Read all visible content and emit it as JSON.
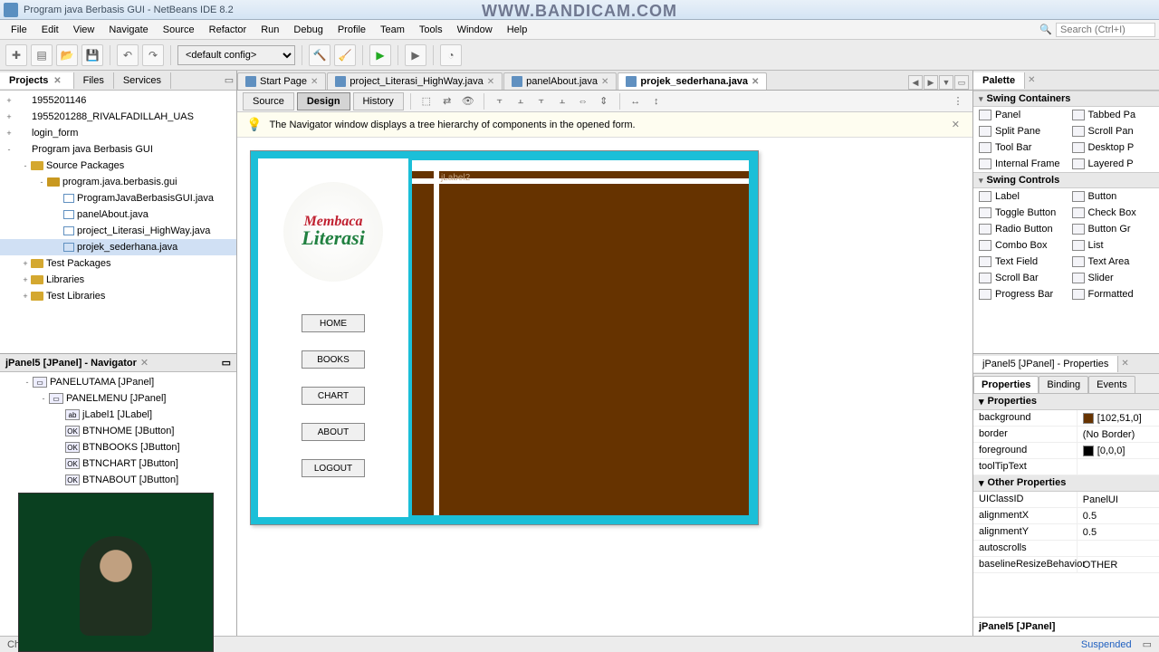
{
  "window": {
    "title": "Program java Berbasis GUI - NetBeans IDE 8.2"
  },
  "watermark": "WWW.BANDICAM.COM",
  "menubar": [
    "File",
    "Edit",
    "View",
    "Navigate",
    "Source",
    "Refactor",
    "Run",
    "Debug",
    "Profile",
    "Team",
    "Tools",
    "Window",
    "Help"
  ],
  "search_placeholder": "Search (Ctrl+I)",
  "toolbar": {
    "config": "<default config>"
  },
  "projects": {
    "tabs": [
      "Projects",
      "Files",
      "Services"
    ],
    "active_tab": 0,
    "nodes": [
      {
        "indent": 0,
        "exp": "+",
        "ico": "coffee",
        "label": "1955201146"
      },
      {
        "indent": 0,
        "exp": "+",
        "ico": "coffee",
        "label": "1955201288_RIVALFADILLAH_UAS"
      },
      {
        "indent": 0,
        "exp": "+",
        "ico": "coffee",
        "label": "login_form"
      },
      {
        "indent": 0,
        "exp": "-",
        "ico": "coffee",
        "label": "Program java Berbasis GUI"
      },
      {
        "indent": 1,
        "exp": "-",
        "ico": "folder",
        "label": "Source Packages"
      },
      {
        "indent": 2,
        "exp": "-",
        "ico": "pkg",
        "label": "program.java.berbasis.gui"
      },
      {
        "indent": 3,
        "exp": "",
        "ico": "java",
        "label": "ProgramJavaBerbasisGUI.java"
      },
      {
        "indent": 3,
        "exp": "",
        "ico": "java",
        "label": "panelAbout.java"
      },
      {
        "indent": 3,
        "exp": "",
        "ico": "java",
        "label": "project_Literasi_HighWay.java"
      },
      {
        "indent": 3,
        "exp": "",
        "ico": "java",
        "label": "projek_sederhana.java",
        "sel": true
      },
      {
        "indent": 1,
        "exp": "+",
        "ico": "folder",
        "label": "Test Packages"
      },
      {
        "indent": 1,
        "exp": "+",
        "ico": "folder",
        "label": "Libraries"
      },
      {
        "indent": 1,
        "exp": "+",
        "ico": "folder",
        "label": "Test Libraries"
      }
    ]
  },
  "navigator": {
    "title": "jPanel5 [JPanel] - Navigator",
    "nodes": [
      {
        "indent": 0,
        "exp": "-",
        "label": "PANELUTAMA [JPanel]"
      },
      {
        "indent": 1,
        "exp": "-",
        "label": "PANELMENU [JPanel]"
      },
      {
        "indent": 2,
        "exp": "",
        "label": "jLabel1 [JLabel]",
        "ico": "lbl"
      },
      {
        "indent": 2,
        "exp": "",
        "label": "BTNHOME [JButton]",
        "ico": "btn"
      },
      {
        "indent": 2,
        "exp": "",
        "label": "BTNBOOKS [JButton]",
        "ico": "btn"
      },
      {
        "indent": 2,
        "exp": "",
        "label": "BTNCHART [JButton]",
        "ico": "btn"
      },
      {
        "indent": 2,
        "exp": "",
        "label": "BTNABOUT [JButton]",
        "ico": "btn"
      }
    ]
  },
  "editor": {
    "tabs": [
      {
        "label": "Start Page"
      },
      {
        "label": "project_Literasi_HighWay.java"
      },
      {
        "label": "panelAbout.java"
      },
      {
        "label": "projek_sederhana.java",
        "active": true
      }
    ],
    "views": [
      "Source",
      "Design",
      "History"
    ],
    "active_view": 1,
    "info": "The Navigator window displays a tree hierarchy of components in the opened form."
  },
  "form": {
    "logo_word1": "Membaca",
    "logo_word2": "Literasi",
    "buttons": [
      "HOME",
      "BOOKS",
      "CHART",
      "ABOUT",
      "LOGOUT"
    ],
    "inner_label": "jLabel2"
  },
  "palette": {
    "title": "Palette",
    "cats": [
      {
        "name": "Swing Containers",
        "items": [
          [
            "Panel",
            "Tabbed Pa"
          ],
          [
            "Split Pane",
            "Scroll Pan"
          ],
          [
            "Tool Bar",
            "Desktop P"
          ],
          [
            "Internal Frame",
            "Layered P"
          ]
        ]
      },
      {
        "name": "Swing Controls",
        "items": [
          [
            "Label",
            "Button"
          ],
          [
            "Toggle Button",
            "Check Box"
          ],
          [
            "Radio Button",
            "Button Gr"
          ],
          [
            "Combo Box",
            "List"
          ],
          [
            "Text Field",
            "Text Area"
          ],
          [
            "Scroll Bar",
            "Slider"
          ],
          [
            "Progress Bar",
            "Formatted"
          ]
        ]
      }
    ]
  },
  "properties": {
    "title": "jPanel5 [JPanel] - Properties",
    "tabs": [
      "Properties",
      "Binding",
      "Events"
    ],
    "active_tab": 0,
    "cats": [
      {
        "name": "Properties",
        "rows": [
          {
            "k": "background",
            "v": "[102,51,0]",
            "sw": "#663300"
          },
          {
            "k": "border",
            "v": "(No Border)"
          },
          {
            "k": "foreground",
            "v": "[0,0,0]",
            "sw": "#000000"
          },
          {
            "k": "toolTipText",
            "v": ""
          }
        ]
      },
      {
        "name": "Other Properties",
        "rows": [
          {
            "k": "UIClassID",
            "v": "PanelUI"
          },
          {
            "k": "alignmentX",
            "v": "0.5"
          },
          {
            "k": "alignmentY",
            "v": "0.5"
          },
          {
            "k": "autoscrolls",
            "v": ""
          },
          {
            "k": "baselineResizeBehavior",
            "v": "OTHER"
          }
        ]
      }
    ],
    "footer": "jPanel5 [JPanel]"
  },
  "statusbar": {
    "left": "Checking for external changes",
    "right": "Suspended"
  }
}
